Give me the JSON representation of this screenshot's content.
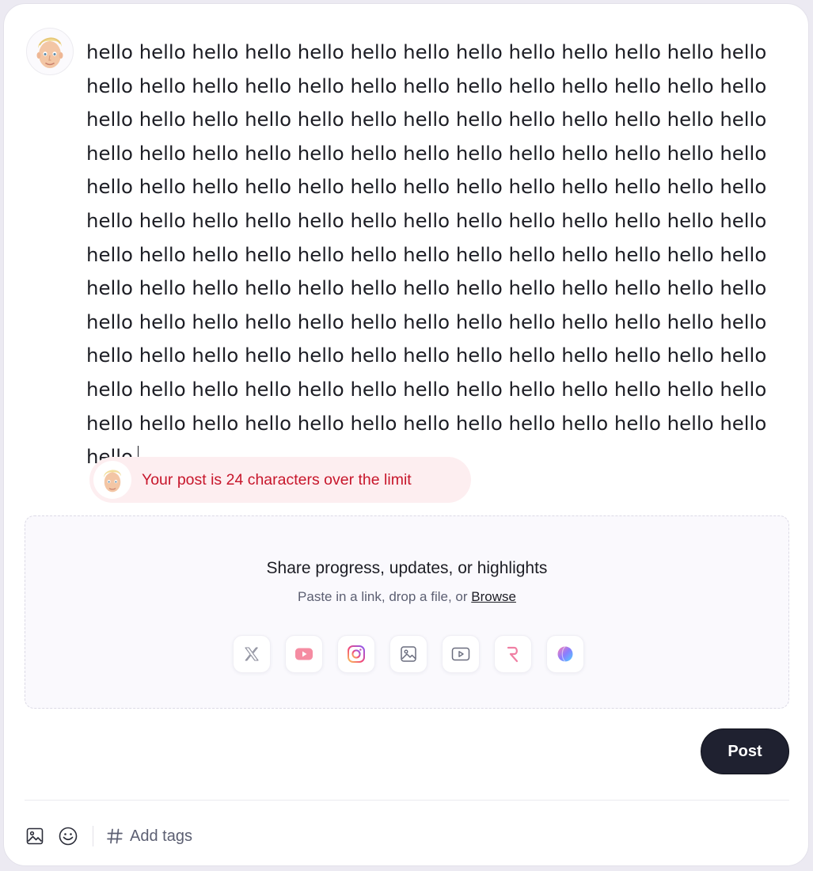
{
  "composer": {
    "post_text": "hello hello hello hello hello hello hello hello hello hello hello hello hello hello hello hello hello hello hello hello hello hello hello hello hello hello hello hello hello hello hello hello hello hello hello hello hello hello hello hello hello hello hello hello hello hello hello hello hello hello hello hello hello hello hello hello hello hello hello hello hello hello hello hello hello hello hello hello hello hello hello hello hello hello hello hello hello hello hello hello hello hello hello hello hello hello hello hello hello hello hello hello hello hello hello hello hello hello hello hello hello hello hello hello hello hello hello hello hello hello hello hello hello hello hello hello hello hello hello hello hello hello hello hello hello hello hello hello hello hello hello hello hello hello hello hello hello hello hello hello hello hello hello hello hello hello hello hello hello hello hello hello hello hello hello hello hello"
  },
  "warning": {
    "text": "Your post is 24 characters over the limit",
    "color": "#c7162b",
    "background": "#fdeef0"
  },
  "dropzone": {
    "title": "Share progress, updates, or highlights",
    "subtitle": "Paste in a link, drop a file, or ",
    "browse_label": "Browse",
    "sources": [
      "x-icon",
      "youtube-icon",
      "instagram-icon",
      "image-icon",
      "video-icon",
      "r-icon",
      "gradient-circle-icon"
    ]
  },
  "actions": {
    "post_label": "Post",
    "post_color": "#1f2130"
  },
  "toolbar": {
    "icons": [
      "image-icon",
      "emoji-icon",
      "hashtag-icon"
    ],
    "tags_placeholder": "Add tags",
    "tags_value": ""
  }
}
